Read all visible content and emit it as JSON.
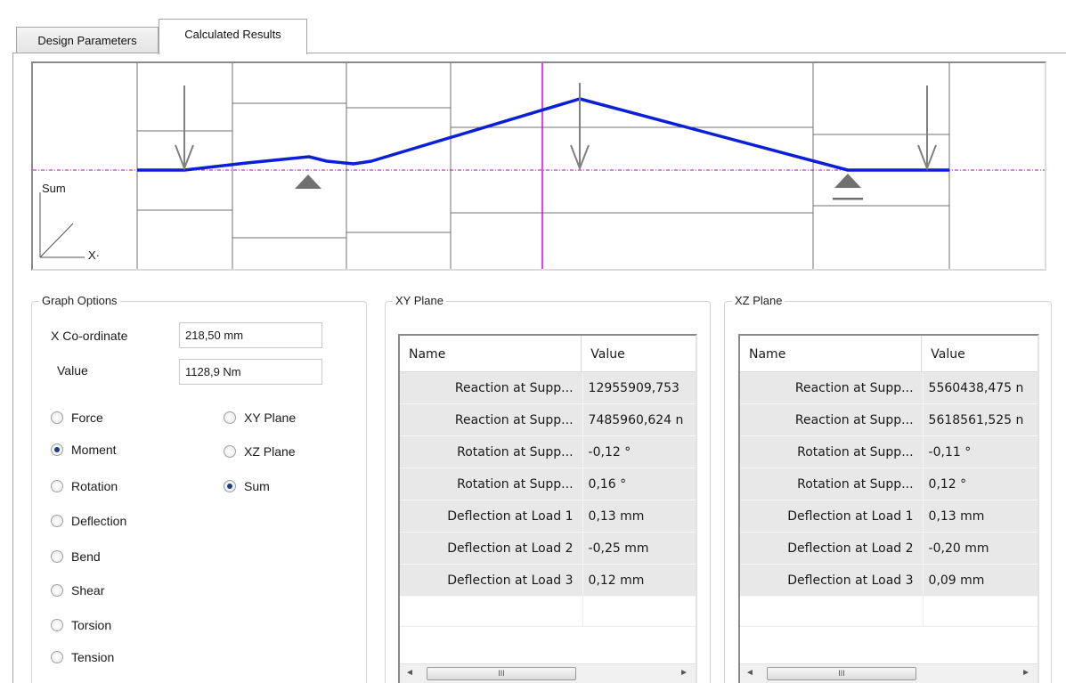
{
  "tabs": [
    {
      "label": "Design Parameters",
      "active": false
    },
    {
      "label": "Calculated Results",
      "active": true
    }
  ],
  "diagram": {
    "graph_label": "Sum",
    "axis_label": "X·",
    "colors": {
      "curve": "#0a1fd6",
      "cursor": "#e000e0",
      "baseline": "#c000c0",
      "grid": "#707070",
      "arrow": "#808080"
    }
  },
  "graph_options": {
    "title": "Graph Options",
    "x_coordinate_label": "X Co-ordinate",
    "x_coordinate_value": "218,50 mm",
    "value_label": "Value",
    "value_value": "1128,9 Nm",
    "quantities": [
      {
        "label": "Force",
        "checked": false
      },
      {
        "label": "Moment",
        "checked": true
      },
      {
        "label": "Rotation",
        "checked": false
      },
      {
        "label": "Deflection",
        "checked": false
      },
      {
        "label": "Bend",
        "checked": false
      },
      {
        "label": "Shear",
        "checked": false
      },
      {
        "label": "Torsion",
        "checked": false
      },
      {
        "label": "Tension",
        "checked": false
      }
    ],
    "planes": [
      {
        "label": "XY Plane",
        "checked": false
      },
      {
        "label": "XZ Plane",
        "checked": false
      },
      {
        "label": "Sum",
        "checked": true
      }
    ]
  },
  "xy_plane": {
    "title": "XY Plane",
    "columns": [
      "Name",
      "Value"
    ],
    "rows": [
      {
        "name": "Reaction at Supp...",
        "value": "12955909,753"
      },
      {
        "name": "Reaction at Supp...",
        "value": "7485960,624 n"
      },
      {
        "name": "Rotation at Supp...",
        "value": "-0,12 °"
      },
      {
        "name": "Rotation at Supp...",
        "value": "0,16 °"
      },
      {
        "name": "Deflection at Load 1",
        "value": "0,13 mm"
      },
      {
        "name": "Deflection at Load 2",
        "value": "-0,25 mm"
      },
      {
        "name": "Deflection at Load 3",
        "value": "0,12 mm"
      }
    ]
  },
  "xz_plane": {
    "title": "XZ Plane",
    "columns": [
      "Name",
      "Value"
    ],
    "rows": [
      {
        "name": "Reaction at Supp...",
        "value": "5560438,475 n"
      },
      {
        "name": "Reaction at Supp...",
        "value": "5618561,525 n"
      },
      {
        "name": "Rotation at Supp...",
        "value": "-0,11 °"
      },
      {
        "name": "Rotation at Supp...",
        "value": "0,12 °"
      },
      {
        "name": "Deflection at Load 1",
        "value": "0,13 mm"
      },
      {
        "name": "Deflection at Load 2",
        "value": "-0,20 mm"
      },
      {
        "name": "Deflection at Load 3",
        "value": "0,09 mm"
      }
    ]
  },
  "scrollbar": {
    "thumb_glyph": "III",
    "left_arrow": "◄",
    "right_arrow": "►"
  }
}
